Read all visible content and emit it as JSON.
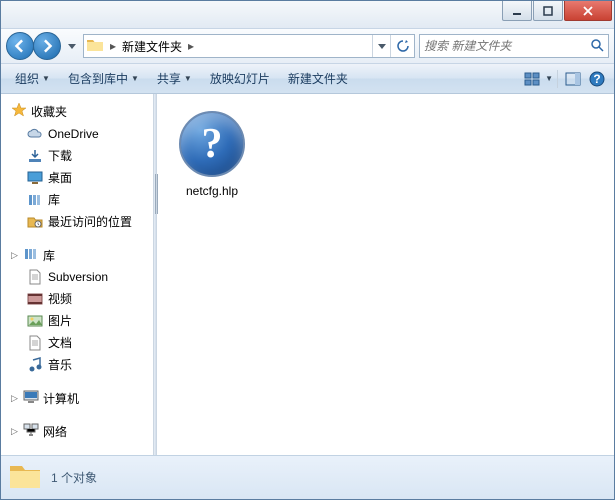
{
  "titlebar": {},
  "nav": {
    "breadcrumb": "新建文件夹",
    "search_placeholder": "搜索 新建文件夹"
  },
  "toolbar": {
    "organize": "组织",
    "include": "包含到库中",
    "share": "共享",
    "slideshow": "放映幻灯片",
    "newfolder": "新建文件夹"
  },
  "sidebar": {
    "favorites": {
      "label": "收藏夹",
      "items": [
        "OneDrive",
        "下载",
        "桌面",
        "库",
        "最近访问的位置"
      ]
    },
    "libraries": {
      "label": "库",
      "items": [
        "Subversion",
        "视频",
        "图片",
        "文档",
        "音乐"
      ]
    },
    "computer": {
      "label": "计算机"
    },
    "network": {
      "label": "网络"
    }
  },
  "files": {
    "items": [
      {
        "name": "netcfg.hlp",
        "icon": "help"
      }
    ]
  },
  "status": {
    "text": "1 个对象"
  }
}
